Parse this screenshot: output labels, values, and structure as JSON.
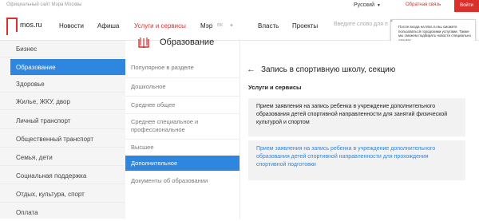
{
  "topbar": {
    "site_note": "Официальный сайт Мэра Москвы",
    "language": "Русский",
    "feedback": "Обратная связь",
    "login": "Войти"
  },
  "header": {
    "logo_text": "mos.ru",
    "nav": [
      "Новости",
      "Афиша",
      "Услуги и сервисы",
      "Мэр",
      "Власть",
      "Проекты"
    ],
    "active_nav": "Услуги и сервисы",
    "search_placeholder": "Введите слово для поиска"
  },
  "tooltip": {
    "text": "После входа на Mos.ru вы сможете пользоваться городскими услугами. Также мы сможем подбирать новости специально для вас."
  },
  "left_menu": {
    "items": [
      "Бизнес",
      "Образование",
      "Здоровье",
      "Жилье, ЖКУ, двор",
      "Личный транспорт",
      "Общественный транспорт",
      "Семья, дети",
      "Социальная поддержка",
      "Отдых, культура, спорт",
      "Оплата"
    ],
    "active": "Образование"
  },
  "middle": {
    "title": "Образование",
    "items": [
      "Популярное в разделе",
      "Дошкольное",
      "Среднее общее",
      "Среднее специальное и профессиональное",
      "Высшее",
      "Дополнительное",
      "Документы об образовании"
    ],
    "active": "Дополнительное"
  },
  "content": {
    "title": "Запись в спортивную школу, секцию",
    "section_label": "Услуги и сервисы",
    "cards": [
      "Прием заявления на запись ребенка в учреждение дополнительного образования детей спортивной направленности для занятий физической культурой и спортом",
      "Прием заявления на запись ребенка в учреждение дополнительного образования детей спортивной направленности для прохождения спортивной подготовки"
    ]
  },
  "colors": {
    "accent_red": "#d9302c",
    "accent_blue": "#2e86de"
  }
}
